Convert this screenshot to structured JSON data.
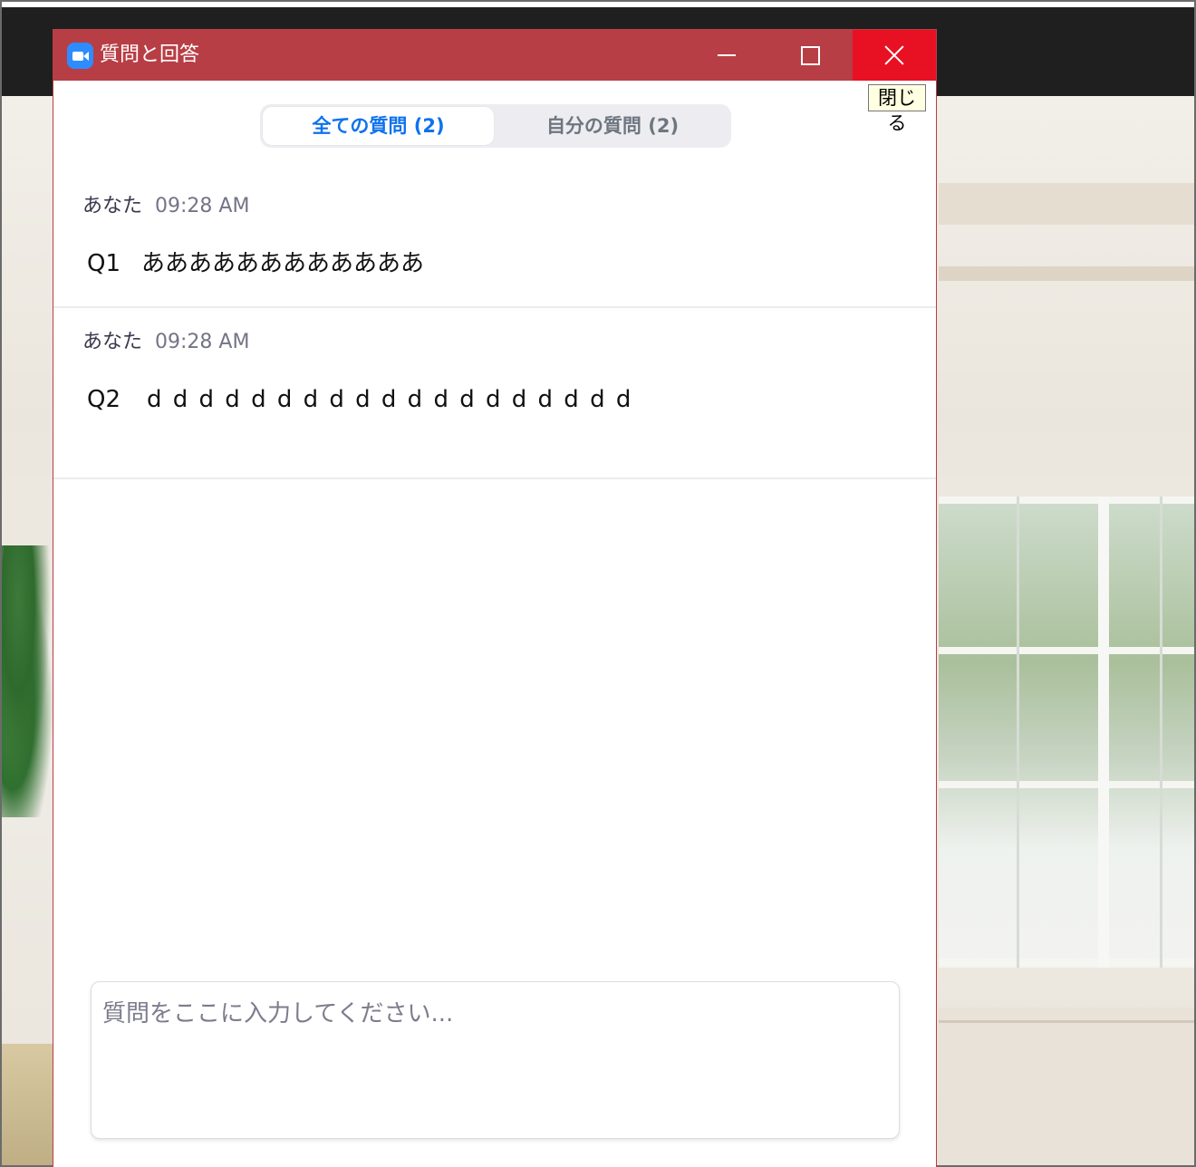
{
  "window": {
    "title": "質問と回答",
    "close_tooltip": "閉じる"
  },
  "tabs": [
    {
      "label": "全ての質問 (2)",
      "active": true
    },
    {
      "label": "自分の質問 (2)",
      "active": false
    }
  ],
  "questions": [
    {
      "author": "あなた",
      "time": "09:28 AM",
      "number": "Q1",
      "text": "ああああああああああああ"
    },
    {
      "author": "あなた",
      "time": "09:28 AM",
      "number": "Q2",
      "text": "d d d d d d d d d d d d d d d d d d d"
    }
  ],
  "input": {
    "placeholder": "質問をここに入力してください...",
    "value": ""
  },
  "colors": {
    "titlebar": "#b83e45",
    "close_hover": "#e81123",
    "accent": "#0e72ed",
    "app_icon": "#2d8cff"
  },
  "icons": [
    "zoom-app-icon",
    "minimize-icon",
    "maximize-icon",
    "close-icon"
  ]
}
